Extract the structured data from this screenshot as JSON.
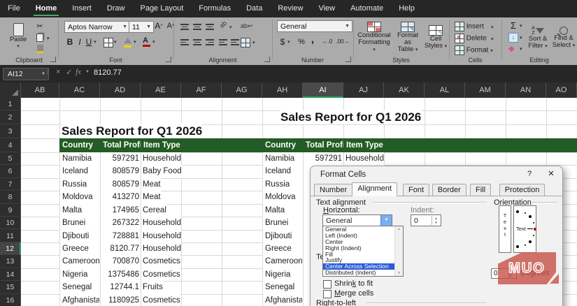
{
  "tabs": [
    {
      "label": "File",
      "active": false
    },
    {
      "label": "Home",
      "active": true
    },
    {
      "label": "Insert",
      "active": false
    },
    {
      "label": "Draw",
      "active": false
    },
    {
      "label": "Page Layout",
      "active": false
    },
    {
      "label": "Formulas",
      "active": false
    },
    {
      "label": "Data",
      "active": false
    },
    {
      "label": "Review",
      "active": false
    },
    {
      "label": "View",
      "active": false
    },
    {
      "label": "Automate",
      "active": false
    },
    {
      "label": "Help",
      "active": false
    }
  ],
  "ribbon": {
    "clipboard": {
      "label": "Clipboard",
      "paste": "Paste"
    },
    "font": {
      "label": "Font",
      "font_name": "Aptos Narrow",
      "font_size": "11",
      "bold": "B",
      "italic": "I",
      "underline": "U",
      "grow": "A",
      "shrink": "A"
    },
    "alignment": {
      "label": "Alignment",
      "wrap": "ab",
      "orient": "ab"
    },
    "number": {
      "label": "Number",
      "format": "General",
      "currency": "$",
      "percent": "%",
      "comma": ",",
      "inc_dec": ".0",
      "dec_dec": ".00"
    },
    "styles": {
      "label": "Styles",
      "cond1": "Conditional",
      "cond2": "Formatting",
      "fmt1": "Format as",
      "fmt2": "Table",
      "cs1": "Cell",
      "cs2": "Styles"
    },
    "cells": {
      "label": "Cells",
      "insert": "Insert",
      "delete": "Delete",
      "format": "Format"
    },
    "editing": {
      "label": "Editing",
      "sigma": "Σ",
      "sort1": "Sort &",
      "sort2": "Filter",
      "find1": "Find &",
      "find2": "Select"
    }
  },
  "formula_bar": {
    "name_box": "AI12",
    "cancel": "×",
    "enter": "✓",
    "fx": "fx",
    "value": "8120.77"
  },
  "sheet": {
    "columns": [
      "AB",
      "AC",
      "AD",
      "AE",
      "AF",
      "AG",
      "AH",
      "AI",
      "AJ",
      "AK",
      "AL",
      "AM",
      "AN",
      "AO"
    ],
    "selected_column": "AI",
    "row_count": 16,
    "selected_row": 12,
    "left_title": "Sales Report for Q1 2026",
    "right_title": "Sales Report for Q1 2026",
    "table_headers": [
      "Country",
      "Total Profi",
      "Item Type"
    ],
    "data": [
      [
        "Namibia",
        "597291",
        "Household"
      ],
      [
        "Iceland",
        "808579",
        "Baby Food"
      ],
      [
        "Russia",
        "808579",
        "Meat"
      ],
      [
        "Moldova",
        "413270",
        "Meat"
      ],
      [
        "Malta",
        "174965",
        "Cereal"
      ],
      [
        "Brunei",
        "267322",
        "Household"
      ],
      [
        "Djibouti",
        "728881",
        "Household"
      ],
      [
        "Greece",
        "8120.77",
        "Household"
      ],
      [
        "Cameroon",
        "700870",
        "Cosmetics"
      ],
      [
        "Nigeria",
        "1375486",
        "Cosmetics"
      ],
      [
        "Senegal",
        "12744.1",
        "Fruits"
      ],
      [
        "Afghanista",
        "1180925",
        "Cosmetics"
      ]
    ]
  },
  "dialog": {
    "title": "Format Cells",
    "help": "?",
    "close": "✕",
    "tabs": [
      "Number",
      "Alignment",
      "Font",
      "Border",
      "Fill",
      "Protection"
    ],
    "active_tab": "Alignment",
    "text_alignment_label": "Text alignment",
    "horizontal_label": {
      "mn": "H",
      "rest": "orizontal:"
    },
    "horizontal_value": "General",
    "indent_label": "Indent:",
    "indent_value": "0",
    "options": [
      "General",
      "Left (Indent)",
      "Center",
      "Right (Indent)",
      "Fill",
      "Justify",
      "Center Across Selection",
      "Distributed (Indent)"
    ],
    "selected_option": "Center Across Selection",
    "text_control_label": "Text control",
    "shrink": {
      "pre": "Shrin",
      "mn": "k",
      "post": " to fit"
    },
    "merge": {
      "mn": "M",
      "post": "erge cells"
    },
    "rtl_label": "Right-to-left",
    "orientation": {
      "label": "Orientation",
      "vertical_letters": [
        "T",
        "e",
        "x",
        "t"
      ],
      "needle_text": "Text",
      "degrees_value": "0",
      "degrees_label": "Degrees"
    }
  },
  "watermark": "MUO",
  "colors": {
    "accent_green": "#21a366",
    "header_green": "#235c25",
    "selection_blue": "#2b5cd7",
    "ribbon_gray": "#ababab",
    "dark_bar": "#262626"
  }
}
